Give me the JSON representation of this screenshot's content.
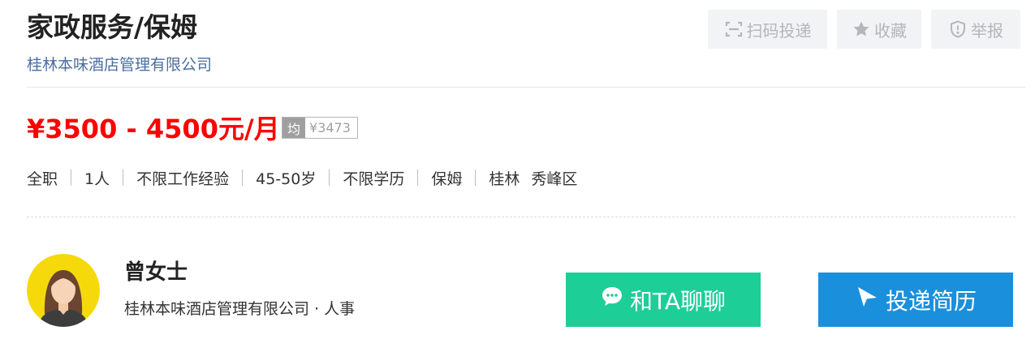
{
  "job": {
    "title": "家政服务/保姆",
    "company": "桂林本味酒店管理有限公司",
    "salary": "¥3500 - 4500元/月",
    "avg_tag": "均",
    "avg_value": "¥3473",
    "meta": [
      "全职",
      "1人",
      "不限工作经验",
      "45-50岁",
      "不限学历",
      "保姆",
      "桂林",
      "秀峰区"
    ]
  },
  "actions": {
    "scan_label": "扫码投递",
    "favorite_label": "收藏",
    "report_label": "举报"
  },
  "recruiter": {
    "name": "曾女士",
    "info": "桂林本味酒店管理有限公司 · 人事"
  },
  "buttons": {
    "chat_label": "和TA聊聊",
    "apply_label": "投递简历"
  },
  "icons": {
    "scan": "scan-icon",
    "favorite": "star-icon",
    "report": "shield-alert-icon",
    "chat": "chat-bubble-icon",
    "apply": "paper-plane-icon",
    "avatar": "female-avatar-icon"
  },
  "colors": {
    "salary": "#ff0000",
    "company_link": "#4a6e9e",
    "chat_button": "#1dce96",
    "apply_button": "#1a90dc",
    "avatar_bg": "#f5d90a"
  }
}
